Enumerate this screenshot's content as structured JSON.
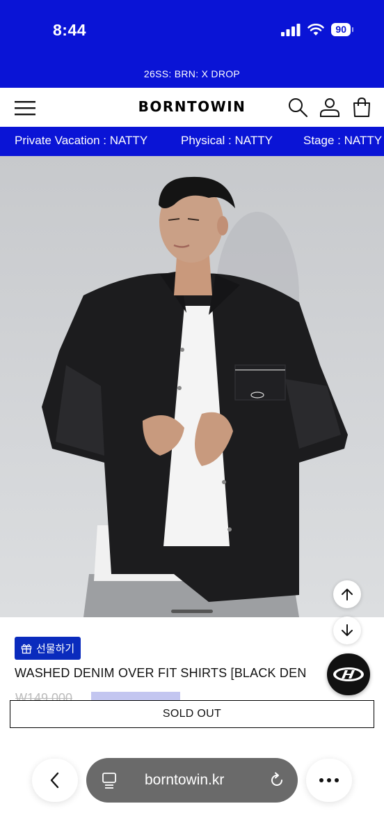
{
  "status_bar": {
    "time": "8:44",
    "battery": "90",
    "background": "#0a14d6"
  },
  "promo_banner": {
    "text": "26SS: BRN: X DROP"
  },
  "header": {
    "logo": "BORNTOWIN",
    "icons": [
      "menu-icon",
      "search-icon",
      "user-icon",
      "cart-icon"
    ]
  },
  "marquee": {
    "items": [
      "Private Vacation : NATTY",
      "Physical : NATTY",
      "Stage : NATTY"
    ]
  },
  "product": {
    "image_alt": "model wearing black washed denim over fit shirt",
    "gift_label": "선물하기",
    "title": "WASHED DENIM OVER FIT SHIRTS [BLACK DEN",
    "price_partial": "W149,000",
    "button_label": "SOLD OUT"
  },
  "browser_bar": {
    "url": "borntowin.kr"
  },
  "colors": {
    "accent_blue": "#0a14d6",
    "gift_blue": "#0a2bbd"
  }
}
